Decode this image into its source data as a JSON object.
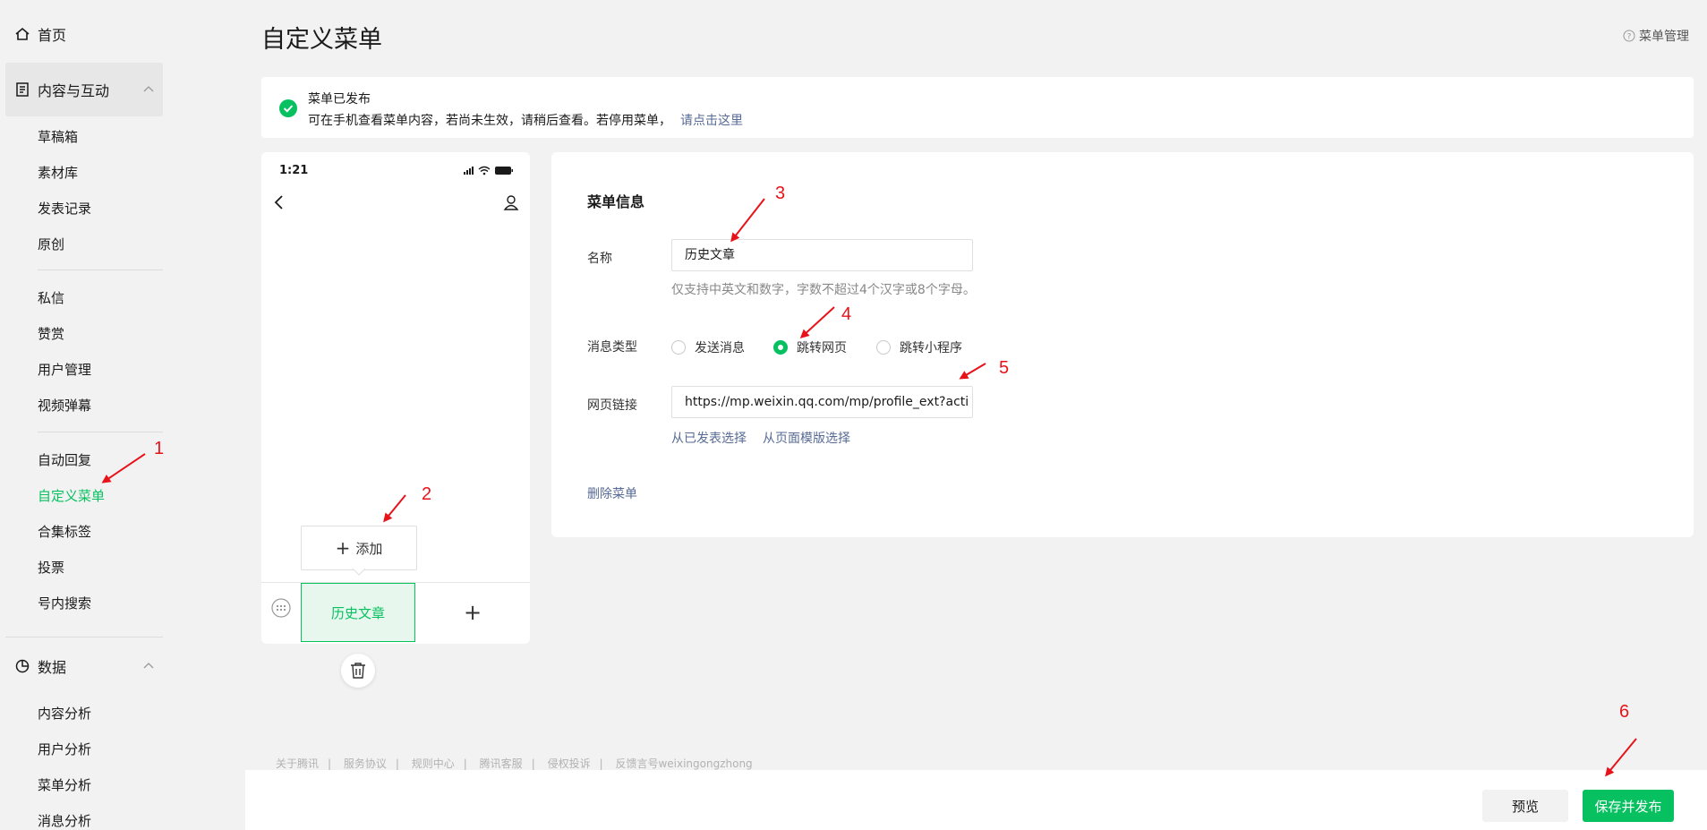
{
  "sidebar": {
    "home": "首页",
    "content_group": "内容与互动",
    "content_items": [
      "草稿箱",
      "素材库",
      "发表记录",
      "原创"
    ],
    "interaction_items": [
      "私信",
      "赞赏",
      "用户管理",
      "视频弹幕"
    ],
    "feature_items": [
      "自动回复",
      "自定义菜单",
      "合集标签",
      "投票",
      "号内搜索"
    ],
    "data_group": "数据",
    "data_items": [
      "内容分析",
      "用户分析",
      "菜单分析",
      "消息分析"
    ]
  },
  "header": {
    "title": "自定义菜单",
    "help": "菜单管理"
  },
  "notice": {
    "title": "菜单已发布",
    "text": "可在手机查看菜单内容，若尚未生效，请稍后查看。若停用菜单，",
    "link": "请点击这里"
  },
  "phone": {
    "time": "1:21",
    "submenu_add": "添加",
    "menu_tab": "历史文章",
    "add_symbol": "+"
  },
  "panel": {
    "title": "菜单信息",
    "name_label": "名称",
    "name_value": "历史文章",
    "name_hint": "仅支持中英文和数字，字数不超过4个汉字或8个字母。",
    "type_label": "消息类型",
    "type_options": [
      "发送消息",
      "跳转网页",
      "跳转小程序"
    ],
    "type_selected": "跳转网页",
    "url_label": "网页链接",
    "url_value": "https://mp.weixin.qq.com/mp/profile_ext?acti",
    "pick_published": "从已发表选择",
    "pick_template": "从页面模版选择",
    "delete": "删除菜单"
  },
  "footer": {
    "links": [
      "关于腾讯",
      "服务协议",
      "规则中心",
      "腾讯客服",
      "侵权投诉",
      "反馈言号weixingongzhong"
    ]
  },
  "actions": {
    "preview": "预览",
    "save": "保存并发布"
  },
  "annotations": [
    "1",
    "2",
    "3",
    "4",
    "5",
    "6"
  ],
  "colors": {
    "accent": "#07c160",
    "link": "#576b95",
    "annotation": "#e8131a"
  }
}
